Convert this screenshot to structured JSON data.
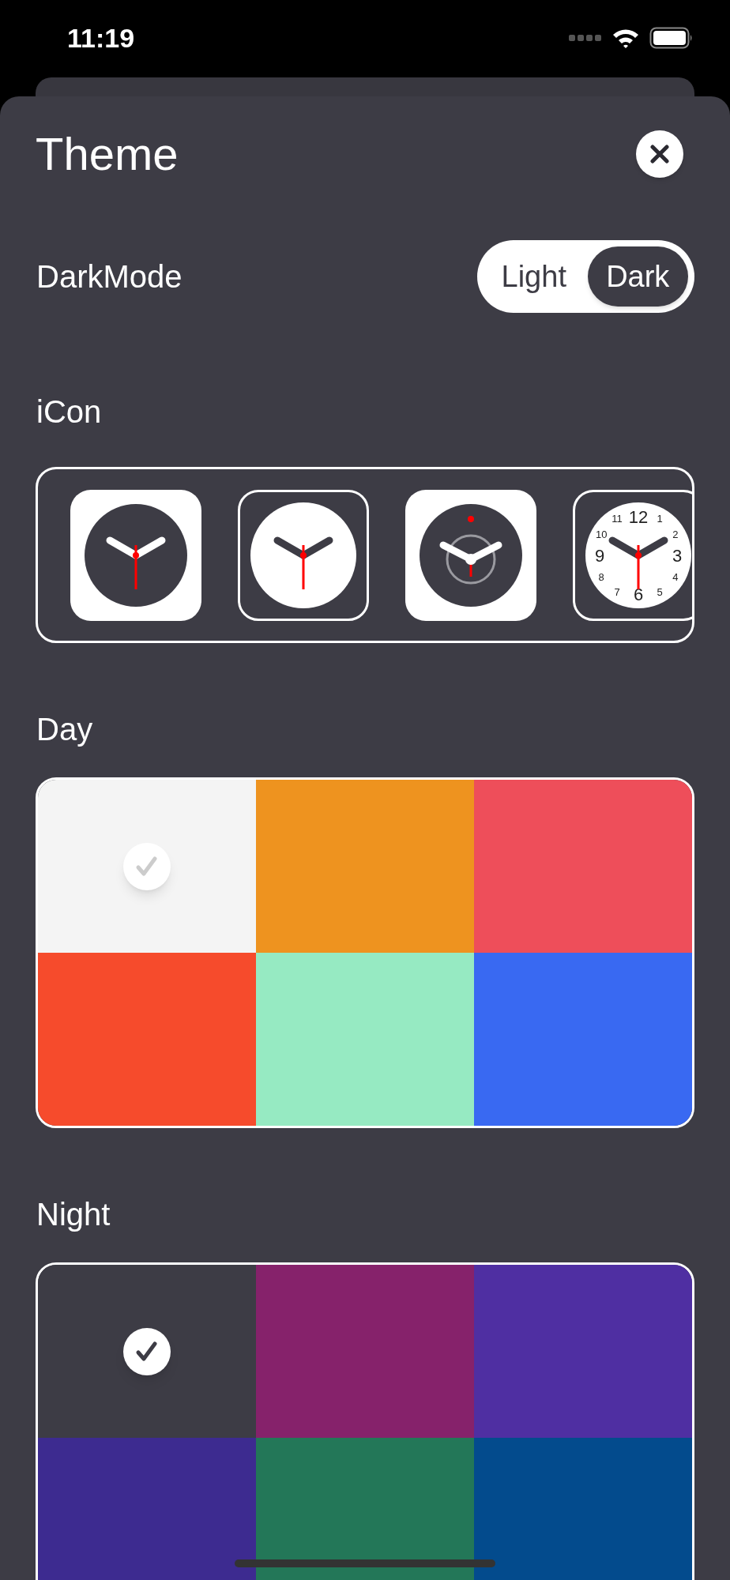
{
  "status_bar": {
    "time": "11:19"
  },
  "sheet": {
    "title": "Theme"
  },
  "dark_mode": {
    "label": "DarkMode",
    "options": [
      {
        "label": "Light",
        "selected": false
      },
      {
        "label": "Dark",
        "selected": true
      }
    ]
  },
  "icon_section": {
    "title": "iCon",
    "icons": [
      {
        "kind": "dark-face",
        "selected": false
      },
      {
        "kind": "light-face",
        "selected": true
      },
      {
        "kind": "ring-face",
        "selected": false
      },
      {
        "kind": "numbered-face",
        "selected": true,
        "numerals": [
          "11",
          "12",
          "1",
          "10",
          "2",
          "9",
          "3",
          "8",
          "4",
          "7",
          "6",
          "5"
        ]
      }
    ]
  },
  "palettes": [
    {
      "title": "Day",
      "kind": "light",
      "swatches": [
        {
          "color": "#f4f4f4",
          "selected": true
        },
        {
          "color": "#ee931f",
          "selected": false
        },
        {
          "color": "#ee4e5a",
          "selected": false
        },
        {
          "color": "#f64b2c",
          "selected": false
        },
        {
          "color": "#96eac2",
          "selected": false
        },
        {
          "color": "#3969f2",
          "selected": false
        }
      ]
    },
    {
      "title": "Night",
      "kind": "dark",
      "swatches": [
        {
          "color": "#3d3c45",
          "selected": true
        },
        {
          "color": "#86226b",
          "selected": false
        },
        {
          "color": "#4f2fa2",
          "selected": false
        },
        {
          "color": "#3d2b90",
          "selected": false
        },
        {
          "color": "#237758",
          "selected": false
        },
        {
          "color": "#034b8d",
          "selected": false
        }
      ]
    }
  ]
}
